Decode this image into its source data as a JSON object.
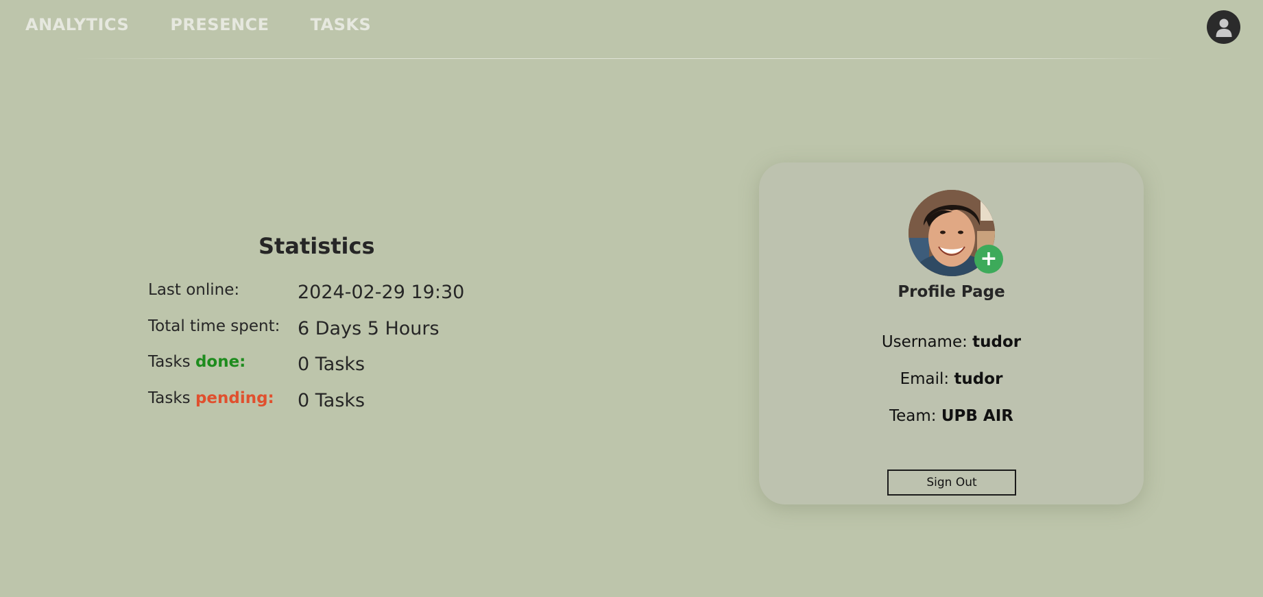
{
  "nav": {
    "links": [
      {
        "label": "ANALYTICS"
      },
      {
        "label": "PRESENCE"
      },
      {
        "label": "TASKS"
      }
    ],
    "account_icon": "user-account-icon"
  },
  "statistics": {
    "title": "Statistics",
    "rows": [
      {
        "label_prefix": "Last online:",
        "label_highlight": "",
        "value": "2024-02-29 19:30"
      },
      {
        "label_prefix": "Total time spent:",
        "label_highlight": "",
        "value": "6 Days 5 Hours"
      },
      {
        "label_prefix": "Tasks ",
        "label_highlight": "done:",
        "value": "0 Tasks"
      },
      {
        "label_prefix": "Tasks ",
        "label_highlight": "pending:",
        "value": "0 Tasks"
      }
    ],
    "colors": {
      "done": "#1e8c1e",
      "pending": "#e0502e"
    }
  },
  "profile": {
    "photo_icon": "profile-photo",
    "add_photo_icon": "plus-icon",
    "add_photo_symbol": "+",
    "title": "Profile Page",
    "username_label": "Username:",
    "username_value": "tudor",
    "email_label": "Email:",
    "email_value": "tudor",
    "team_label": "Team:",
    "team_value": "UPB AIR",
    "signout_label": "Sign Out"
  },
  "colors": {
    "background": "#bdc5ab",
    "card": "#bdc2af",
    "add_button": "#3daa5a"
  }
}
